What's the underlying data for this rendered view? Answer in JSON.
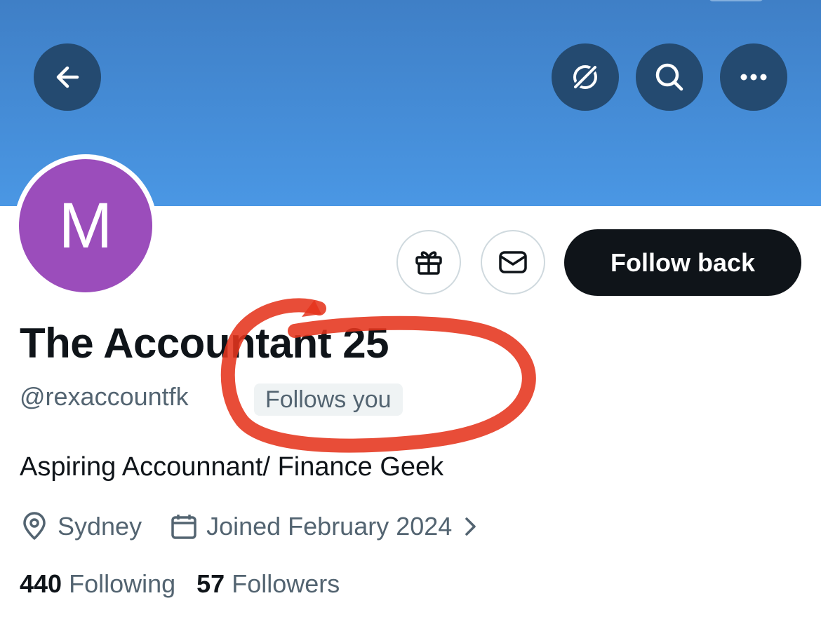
{
  "header": {
    "back_icon": "arrow-left-icon",
    "grok_icon": "grok-icon",
    "search_icon": "search-icon",
    "more_icon": "more-horizontal-icon",
    "banner_color": "#4a97e4"
  },
  "profile": {
    "avatar_letter": "M",
    "avatar_color": "#9b4dbb",
    "display_name": "The Accountant 25",
    "handle": "@rexaccountfk",
    "follows_you_badge": "Follows you",
    "bio": "Aspiring Accounnant/ Finance Geek",
    "location": "Sydney",
    "joined": "Joined February 2024"
  },
  "actions": {
    "gift_icon": "gift-icon",
    "message_icon": "envelope-icon",
    "follow_back_label": "Follow back"
  },
  "stats": {
    "following_count": "440",
    "following_label": "Following",
    "followers_count": "57",
    "followers_label": "Followers"
  },
  "annotation": {
    "color": "#e5341c"
  }
}
